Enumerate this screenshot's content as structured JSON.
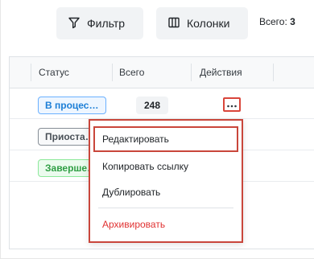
{
  "toolbar": {
    "filter_label": "Фильтр",
    "columns_label": "Колонки",
    "total_label": "Всего:",
    "total_value": "3"
  },
  "table": {
    "headers": [
      "Статус",
      "Всего",
      "Действия"
    ],
    "rows": [
      {
        "status": "В процес…",
        "status_color": "blue",
        "total": "248"
      },
      {
        "status": "Приоста…",
        "status_color": "gray",
        "total": ""
      },
      {
        "status": "Заверше…",
        "status_color": "green",
        "total": ""
      }
    ]
  },
  "menu": {
    "items": [
      {
        "label": "Редактировать"
      },
      {
        "label": "Копировать ссылку"
      },
      {
        "label": "Дублировать"
      },
      {
        "label": "Архивировать"
      }
    ]
  },
  "icons": {
    "filter": "filter-icon",
    "columns": "columns-icon",
    "more": "ellipsis-icon"
  },
  "colors": {
    "highlight": "#c9463b",
    "danger": "#e03131",
    "status_blue": "#1c7ed6",
    "status_green": "#2f9e44"
  }
}
